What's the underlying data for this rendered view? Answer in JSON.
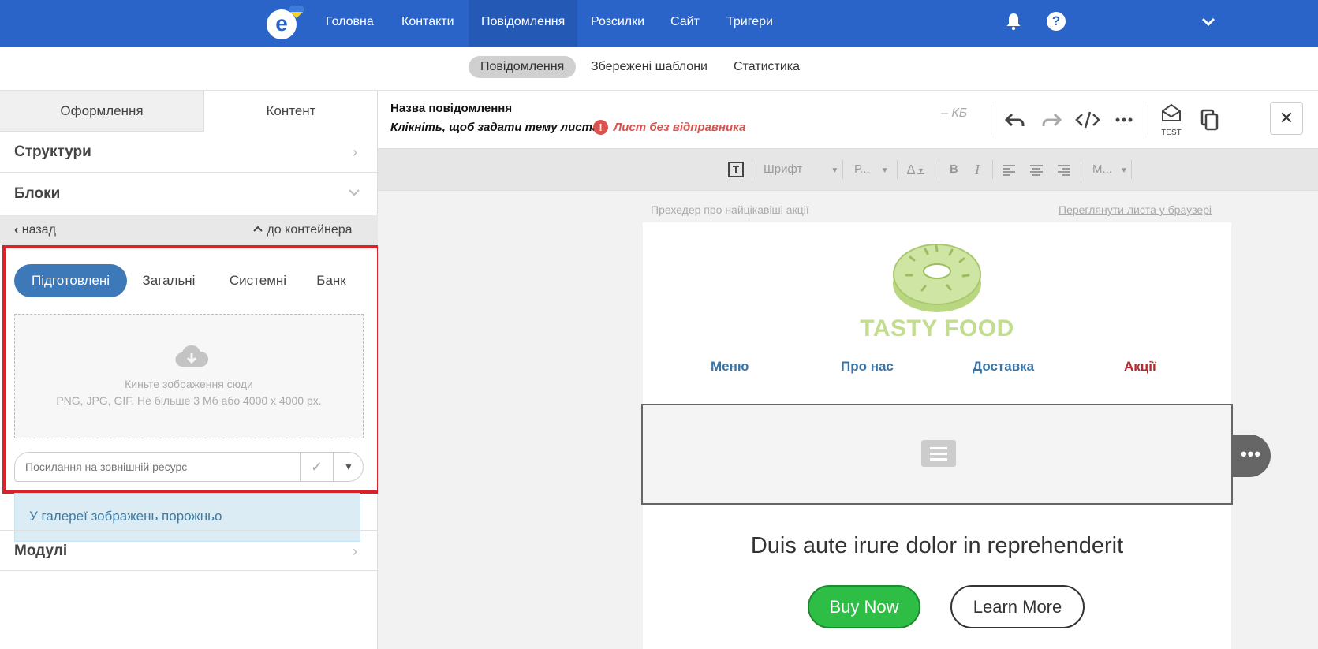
{
  "topnav": {
    "logo_icon": "esputnik-logo-icon",
    "items": [
      "Головна",
      "Контакти",
      "Повідомлення",
      "Розсилки",
      "Сайт",
      "Тригери"
    ],
    "active_index": 2,
    "icons": [
      "bell-icon",
      "help-icon",
      "chevron-down-icon"
    ],
    "help_glyph": "?",
    "bg_color": "#2b64c8"
  },
  "subnav": {
    "items": [
      "Повідомлення",
      "Збережені шаблони",
      "Статистика"
    ],
    "active_index": 0
  },
  "left_panel": {
    "tabs": [
      "Оформлення",
      "Контент"
    ],
    "active_tab": 1,
    "sections": {
      "structures": "Структури",
      "blocks": "Блоки",
      "modules": "Модулі"
    },
    "back_label": "назад",
    "to_container_label": "до контейнера",
    "image_tabs": [
      "Підготовлені",
      "Загальні",
      "Системні",
      "Банк"
    ],
    "active_image_tab": 0,
    "dropzone": {
      "line1": "Киньте зображення сюди",
      "line2": "PNG, JPG, GIF. Не більше 3 Мб або 4000 x 4000 px."
    },
    "url_placeholder": "Посилання на зовнішній ресурс",
    "gallery_empty": "У галереї зображень порожньо"
  },
  "editor_header": {
    "message_name": "Назва повідомлення",
    "subject_prompt": "Клікніть, щоб задати тему листа",
    "warning": "Лист без відправника",
    "size": "– КБ",
    "test_label": "TEST",
    "close_glyph": "✕",
    "tools": [
      "undo-icon",
      "redo-icon",
      "code-icon",
      "more-icon",
      "test-send-icon",
      "copy-icon",
      "close-icon"
    ]
  },
  "format_toolbar": {
    "font_label": "Шрифт",
    "size_label": "Р...",
    "more_label": "М...",
    "bold": "B",
    "italic": "I"
  },
  "email": {
    "preheader": "Прехедер про найцікавіші акції",
    "browser_link": "Переглянути листа у браузері",
    "brand": "TASTY FOOD",
    "menu": [
      "Меню",
      "Про нас",
      "Доставка",
      "Акції"
    ],
    "headline": "Duis aute irure dolor in reprehenderit",
    "buy_button": "Buy Now",
    "learn_button": "Learn More",
    "more_glyph": "•••",
    "colors": {
      "brand": "#c3dc8f",
      "menu_link": "#3874a8",
      "menu_highlight": "#b22a2a",
      "buy_button": "#2fbe45"
    }
  },
  "highlight_color": "#d9222a"
}
